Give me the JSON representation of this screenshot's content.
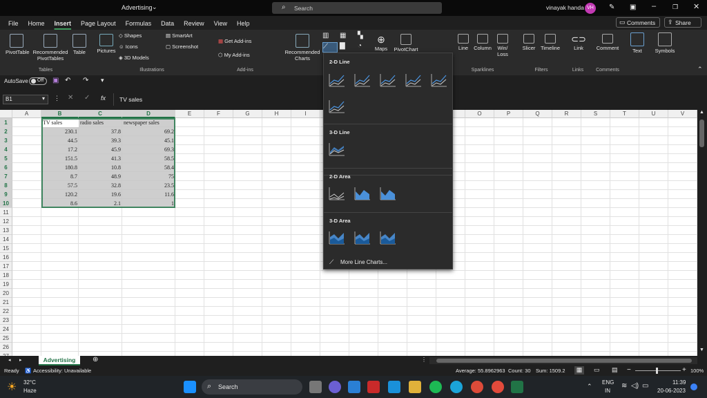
{
  "titlebar": {
    "doc_title": "Advertising",
    "search_label": "Search",
    "user_name": "vinayak handa",
    "user_initials": "VH"
  },
  "menu": {
    "tabs": [
      "File",
      "Home",
      "Insert",
      "Page Layout",
      "Formulas",
      "Data",
      "Review",
      "View",
      "Help"
    ],
    "active": "Insert",
    "comments_label": "Comments",
    "share_label": "Share"
  },
  "ribbon": {
    "tables": {
      "pivot": "PivotTable",
      "recommended": "Recommended PivotTables",
      "table": "Table",
      "label": "Tables"
    },
    "illustrations": {
      "pictures": "Pictures",
      "shapes": "Shapes",
      "icons": "Icons",
      "models": "3D Models",
      "smartart": "SmartArt",
      "screenshot": "Screenshot",
      "label": "Illustrations"
    },
    "addins": {
      "get": "Get Add-ins",
      "my": "My Add-ins",
      "label": "Add-ins"
    },
    "charts": {
      "recommended": "Recommended Charts",
      "maps": "Maps",
      "pivotchart": "PivotChart"
    },
    "sparklines": {
      "line": "Line",
      "column": "Column",
      "winloss": "Win/ Loss",
      "label": "Sparklines"
    },
    "filters": {
      "slicer": "Slicer",
      "timeline": "Timeline",
      "label": "Filters"
    },
    "links": {
      "link": "Link",
      "label": "Links"
    },
    "comments": {
      "comment": "Comment",
      "label": "Comments"
    },
    "text": {
      "text": "Text",
      "symbols": "Symbols"
    }
  },
  "qat": {
    "autosave": "AutoSave",
    "toggle": "Off"
  },
  "formula": {
    "namebox": "B1",
    "fx": "fx",
    "value": "TV sales"
  },
  "grid": {
    "columns": [
      "A",
      "B",
      "C",
      "D",
      "E",
      "F",
      "G",
      "H",
      "I",
      "J",
      "K",
      "L",
      "M",
      "N",
      "O",
      "P",
      "Q",
      "R",
      "S",
      "T",
      "U",
      "V"
    ],
    "rows": [
      "1",
      "2",
      "3",
      "4",
      "5",
      "6",
      "7",
      "8",
      "9",
      "10",
      "11",
      "12",
      "13",
      "14",
      "15",
      "16",
      "17",
      "18",
      "19",
      "20",
      "21",
      "22",
      "23",
      "24",
      "25",
      "26",
      "27"
    ],
    "headers": [
      "TV sales",
      "radio sales",
      "newspaper sales"
    ],
    "data": [
      [
        "230.1",
        "37.8",
        "69.2"
      ],
      [
        "44.5",
        "39.3",
        "45.1"
      ],
      [
        "17.2",
        "45.9",
        "69.3"
      ],
      [
        "151.5",
        "41.3",
        "58.5"
      ],
      [
        "180.8",
        "10.8",
        "58.4"
      ],
      [
        "8.7",
        "48.9",
        "75"
      ],
      [
        "57.5",
        "32.8",
        "23.5"
      ],
      [
        "120.2",
        "19.6",
        "11.6"
      ],
      [
        "8.6",
        "2.1",
        "1"
      ]
    ]
  },
  "dropdown": {
    "line2d": "2-D Line",
    "line3d": "3-D Line",
    "area2d": "2-D Area",
    "area3d": "3-D Area",
    "more": "More Line Charts..."
  },
  "sheet": {
    "active_tab": "Advertising"
  },
  "status": {
    "ready": "Ready",
    "accessibility": "Accessibility: Unavailable",
    "average": "Average: 55.8962963",
    "count": "Count: 30",
    "sum": "Sum: 1509.2",
    "zoom": "100%"
  },
  "taskbar": {
    "temp": "32°C",
    "weather": "Haze",
    "search": "Search",
    "lang1": "ENG",
    "lang2": "IN",
    "time": "11:39",
    "date": "20-06-2023"
  },
  "colors": {
    "excel_green": "#217346",
    "accent": "#4a90d9",
    "selection": "#c6c6c6"
  }
}
